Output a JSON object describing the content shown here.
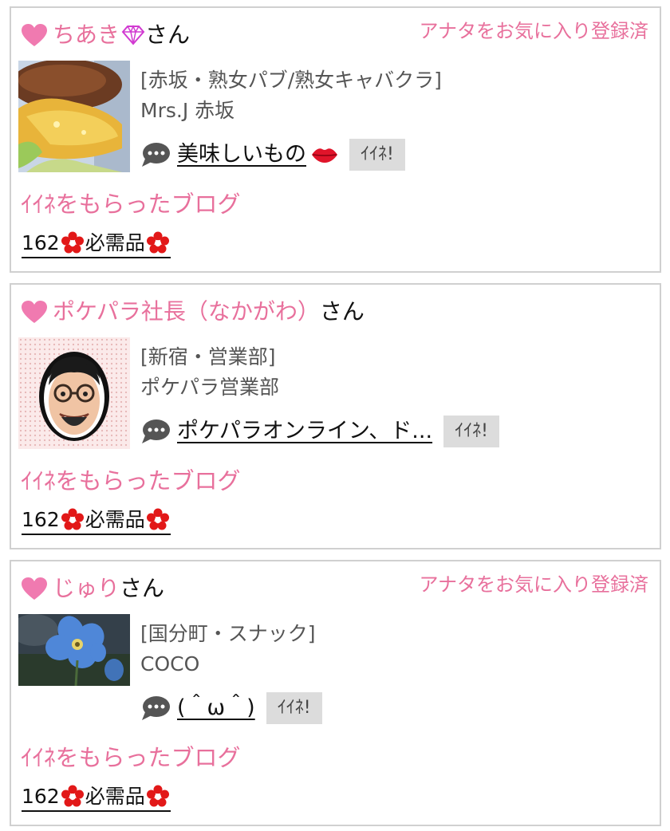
{
  "colors": {
    "pink": "#e8709c",
    "border": "#d0d0d0",
    "button_bg": "#dcdcdc",
    "flower": "#e21818"
  },
  "cards": [
    {
      "user_name": "ちあき",
      "name_icon": "gem-icon",
      "honorific": "さん",
      "fav_status": "アナタをお気に入り登録済",
      "thumbnail": "burger-photo",
      "category": "[赤坂・熟女パブ/熟女キャバクラ]",
      "shop": "Mrs.J 赤坂",
      "post_title": "美味しいもの",
      "post_icon": "lips-icon",
      "like_label": "ｲｲﾈ!",
      "section_title": "ｲｲﾈをもらったブログ",
      "blog_number": "162",
      "blog_title": "必需品"
    },
    {
      "user_name": "ポケパラ社長（なかがわ）",
      "honorific": "さん",
      "fav_status": "",
      "thumbnail": "man-portrait",
      "category": "[新宿・営業部]",
      "shop": "ポケパラ営業部",
      "post_title": "ポケパラオンライン、ド...",
      "like_label": "ｲｲﾈ!",
      "section_title": "ｲｲﾈをもらったブログ",
      "blog_number": "162",
      "blog_title": "必需品"
    },
    {
      "user_name": "じゅり",
      "honorific": "さん",
      "fav_status": "アナタをお気に入り登録済",
      "thumbnail": "blue-flower-photo",
      "category": "[国分町・スナック]",
      "shop": "COCO",
      "post_title": "(＾ω＾)",
      "like_label": "ｲｲﾈ!",
      "section_title": "ｲｲﾈをもらったブログ",
      "blog_number": "162",
      "blog_title": "必需品"
    }
  ]
}
